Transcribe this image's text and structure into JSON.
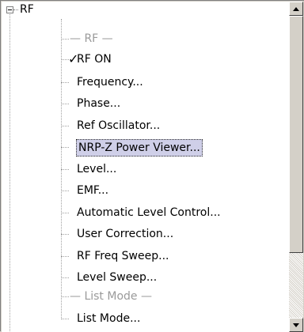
{
  "tree": {
    "root_label": "RF",
    "items": [
      {
        "label": "— RF —",
        "type": "separator"
      },
      {
        "label": "RF ON",
        "type": "check",
        "checked": true
      },
      {
        "label": "Frequency...",
        "type": "item"
      },
      {
        "label": "Phase...",
        "type": "item"
      },
      {
        "label": "Ref Oscillator...",
        "type": "item"
      },
      {
        "label": "NRP-Z Power Viewer...",
        "type": "item",
        "selected": true
      },
      {
        "label": "Level...",
        "type": "item"
      },
      {
        "label": "EMF...",
        "type": "item"
      },
      {
        "label": "Automatic Level Control...",
        "type": "item"
      },
      {
        "label": "User Correction...",
        "type": "item"
      },
      {
        "label": "RF Freq Sweep...",
        "type": "item"
      },
      {
        "label": "Level Sweep...",
        "type": "item"
      },
      {
        "label": "— List Mode —",
        "type": "separator"
      },
      {
        "label": "List Mode...",
        "type": "item"
      }
    ]
  },
  "icons": {
    "expander": "collapse-minus-icon",
    "check": "checkmark-icon",
    "scroll_up": "scroll-up-arrow-icon",
    "scroll_down": "scroll-down-arrow-icon"
  },
  "colors": {
    "selection_bg": "#cfcfe8",
    "separator_text": "#9a9a9a",
    "panel_bg": "#d4d0c8"
  },
  "checkmark_glyph": "✓"
}
